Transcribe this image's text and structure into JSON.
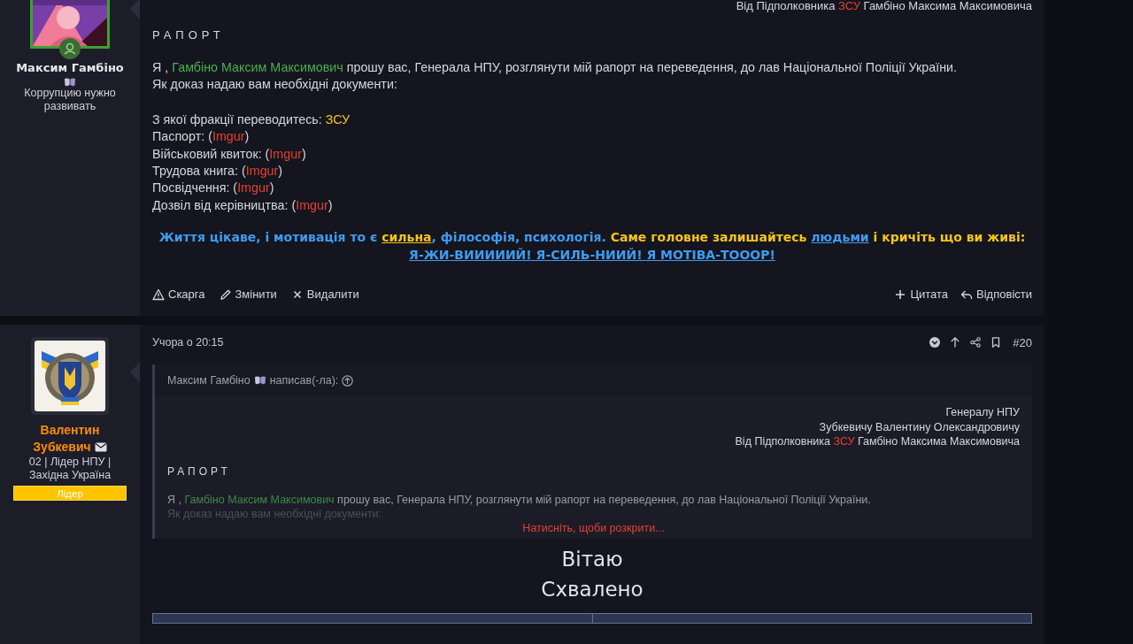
{
  "posts": [
    {
      "author": {
        "name": "Максим Гамбіно",
        "color": "#e8e8e8",
        "title": "Коррупцию нужно развивать",
        "online": true
      },
      "body": {
        "top_line": [
          {
            "kind": "plain",
            "text": "Від Підполковника "
          },
          {
            "kind": "red",
            "text": "ЗСУ"
          },
          {
            "kind": "plain",
            "text": " Гамбіно Максима Максимовича"
          }
        ],
        "heading": "РАПОРТ",
        "paragraphs": [
          [
            [
              {
                "kind": "plain",
                "text": "Я , "
              },
              {
                "kind": "user-link",
                "text": "Гамбіно Максим Максимович"
              },
              {
                "kind": "plain",
                "text": " прошу вас, Генерала НПУ, розглянути мій рапорт на переведення, до лав Національної Поліції України."
              }
            ],
            [
              {
                "kind": "plain",
                "text": "Як доказ надаю вам необхідні документи:"
              }
            ]
          ],
          [
            [
              {
                "kind": "plain",
                "text": "З якої фракції переводитесь: "
              },
              {
                "kind": "gold",
                "text": "ЗСУ"
              }
            ],
            [
              {
                "kind": "plain",
                "text": "Паспорт: ("
              },
              {
                "kind": "link",
                "text": "Imgur"
              },
              {
                "kind": "plain",
                "text": ")"
              }
            ],
            [
              {
                "kind": "plain",
                "text": "Військовий квиток: ("
              },
              {
                "kind": "link",
                "text": "Imgur"
              },
              {
                "kind": "plain",
                "text": ")"
              }
            ],
            [
              {
                "kind": "plain",
                "text": "Трудова книга: ("
              },
              {
                "kind": "link",
                "text": "Imgur"
              },
              {
                "kind": "plain",
                "text": ")"
              }
            ],
            [
              {
                "kind": "plain",
                "text": "Посвідчення: ("
              },
              {
                "kind": "link",
                "text": "Imgur"
              },
              {
                "kind": "plain",
                "text": ")"
              }
            ],
            [
              {
                "kind": "plain",
                "text": "Дозвіл від керівництва: ("
              },
              {
                "kind": "link",
                "text": "Imgur"
              },
              {
                "kind": "plain",
                "text": ")"
              }
            ]
          ]
        ],
        "motivation": [
          [
            {
              "kind": "blue",
              "text": "Життя цікаве, і мотивація то є "
            },
            {
              "kind": "gold-u",
              "text": "сильна"
            },
            {
              "kind": "blue",
              "text": ", філософія, психологія. "
            },
            {
              "kind": "gold",
              "text": "Саме головне залишайтесь "
            },
            {
              "kind": "blue-u",
              "text": "людьми"
            },
            {
              "kind": "gold",
              "text": " і кричіть що ви живі:"
            }
          ],
          [
            {
              "kind": "blue-u",
              "text": "Я-ЖИ-ВИИИИИЙ! "
            },
            {
              "kind": "blue-u",
              "text": "Я-СИЛЬ-НИИЙ! Я МОТІВА-ТОООР!"
            }
          ]
        ]
      },
      "actions_left": [
        {
          "label": "Скарга"
        },
        {
          "label": "Змінити"
        },
        {
          "label": "Видалити"
        }
      ],
      "actions_right": [
        {
          "label": "Цитата"
        },
        {
          "label": "Відповісти"
        }
      ]
    },
    {
      "author": {
        "name": "Валентин Зубкевич",
        "color": "#ff8c00",
        "title": "02 | Лідер НПУ | Західна Україна",
        "role": "Лідер"
      },
      "date": "Учора о 20:15",
      "number": "#20",
      "quote": {
        "author": "Максим Гамбіно",
        "says": "написав(-ла):",
        "right_lines": [
          [
            {
              "kind": "plain",
              "text": "Генералу НПУ"
            }
          ],
          [
            {
              "kind": "plain",
              "text": "Зубкевичу Валентину Олександровичу"
            }
          ],
          [
            {
              "kind": "plain",
              "text": "Від Підполковника "
            },
            {
              "kind": "red",
              "text": "ЗСУ"
            },
            {
              "kind": "plain",
              "text": " Гамбіно Максима Максимовича"
            }
          ]
        ],
        "heading": "РАПОРТ",
        "lines": [
          [
            {
              "kind": "plain",
              "text": "Я , "
            },
            {
              "kind": "user-link",
              "text": "Гамбіно Максим Максимович"
            },
            {
              "kind": "plain",
              "text": " прошу вас, Генерала НПУ, розглянути мій рапорт на переведення, до лав Національної Поліції України."
            }
          ],
          [
            {
              "kind": "plain",
              "text": "Як доказ надаю вам необхідні документи:"
            }
          ]
        ],
        "expand": "Натисніть, щоби розкрити..."
      },
      "big_lines": [
        "Вітаю",
        "Схвалено"
      ]
    }
  ]
}
